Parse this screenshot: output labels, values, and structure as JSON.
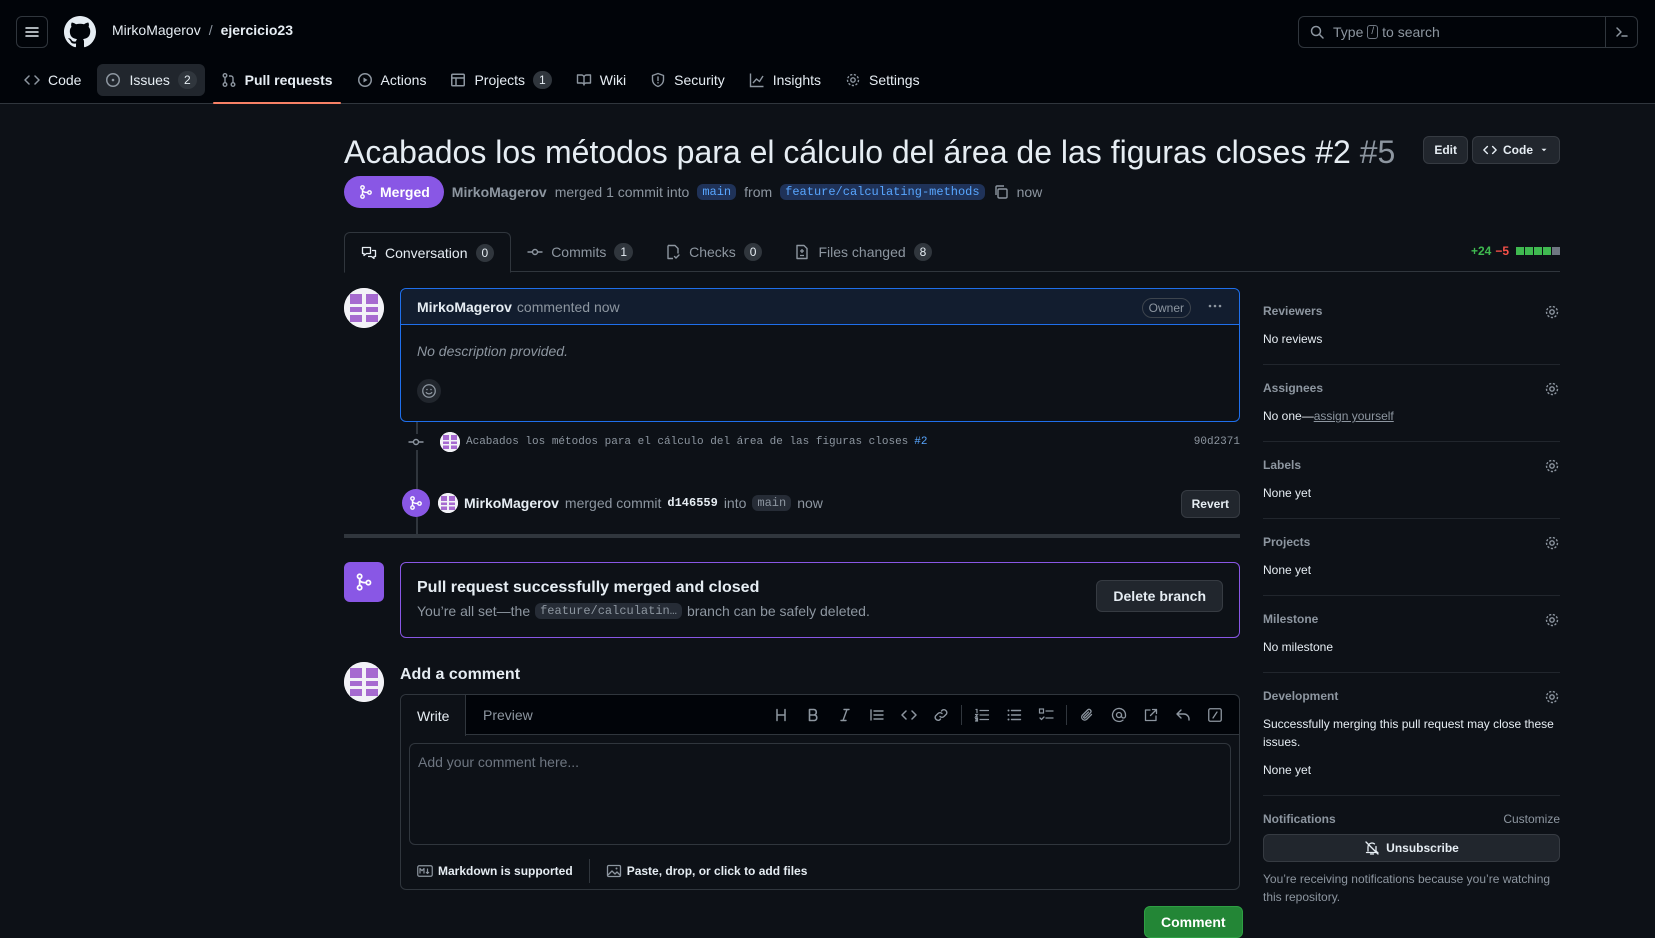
{
  "header": {
    "owner": "MirkoMagerov",
    "separator": "/",
    "repo": "ejercicio23",
    "search_placeholder_pre": "Type",
    "search_key": "/",
    "search_placeholder_post": "to search"
  },
  "repo_nav": [
    {
      "label": "Code",
      "icon": "code-icon"
    },
    {
      "label": "Issues",
      "icon": "issue-icon",
      "count": "2"
    },
    {
      "label": "Pull requests",
      "icon": "pull-request-icon"
    },
    {
      "label": "Actions",
      "icon": "play-icon"
    },
    {
      "label": "Projects",
      "icon": "table-icon",
      "count": "1"
    },
    {
      "label": "Wiki",
      "icon": "book-icon"
    },
    {
      "label": "Security",
      "icon": "shield-icon"
    },
    {
      "label": "Insights",
      "icon": "graph-icon"
    },
    {
      "label": "Settings",
      "icon": "gear-icon"
    }
  ],
  "pr": {
    "title": "Acabados los métodos para el cálculo del área de las figuras closes #2",
    "number": "#5",
    "edit_label": "Edit",
    "code_label": "Code",
    "state": "Merged",
    "author": "MirkoMagerov",
    "merged_text": "merged 1 commit into",
    "base_branch": "main",
    "from_text": "from",
    "head_branch": "feature/calculating-methods",
    "time": "now"
  },
  "tabs": [
    {
      "label": "Conversation",
      "count": "0",
      "icon": "comment-discussion-icon"
    },
    {
      "label": "Commits",
      "count": "1",
      "icon": "commit-icon"
    },
    {
      "label": "Checks",
      "count": "0",
      "icon": "checklist-icon"
    },
    {
      "label": "Files changed",
      "count": "8",
      "icon": "file-diff-icon"
    }
  ],
  "diffstat": {
    "additions": "+24",
    "deletions": "−5",
    "green_boxes": 4,
    "total_boxes": 5
  },
  "comment": {
    "author": "MirkoMagerov",
    "action": "commented now",
    "badge": "Owner",
    "body": "No description provided."
  },
  "commit": {
    "message": "Acabados los métodos para el cálculo del área de las figuras closes",
    "issue_ref": "#2",
    "sha": "90d2371"
  },
  "merge_event": {
    "author": "MirkoMagerov",
    "text1": "merged commit",
    "sha": "d146559",
    "text2": "into",
    "branch": "main",
    "time": "now",
    "revert_label": "Revert"
  },
  "merged_box": {
    "title": "Pull request successfully merged and closed",
    "sub_pre": "You’re all set—the",
    "branch": "feature/calculatin…",
    "sub_post": "branch can be safely deleted.",
    "delete_label": "Delete branch"
  },
  "add_comment": {
    "title": "Add a comment",
    "write_tab": "Write",
    "preview_tab": "Preview",
    "placeholder": "Add your comment here...",
    "markdown_note": "Markdown is supported",
    "files_note": "Paste, drop, or click to add files",
    "submit_label": "Comment"
  },
  "sidebar": {
    "reviewers": {
      "title": "Reviewers",
      "value": "No reviews"
    },
    "assignees": {
      "title": "Assignees",
      "value": "No one—",
      "link": "assign yourself"
    },
    "labels": {
      "title": "Labels",
      "value": "None yet"
    },
    "projects": {
      "title": "Projects",
      "value": "None yet"
    },
    "milestone": {
      "title": "Milestone",
      "value": "No milestone"
    },
    "development": {
      "title": "Development",
      "note": "Successfully merging this pull request may close these issues.",
      "value": "None yet"
    },
    "notifications": {
      "title": "Notifications",
      "customize": "Customize",
      "button": "Unsubscribe",
      "note": "You’re receiving notifications because you’re watching this repository."
    }
  },
  "colors": {
    "accent": "#8957e5",
    "link": "#58a6ff",
    "success": "#238636",
    "tab_underline": "#f78166"
  }
}
